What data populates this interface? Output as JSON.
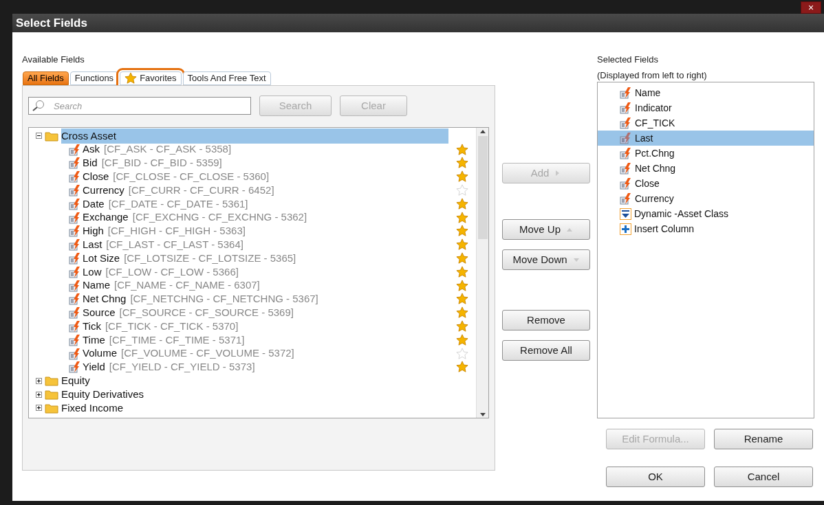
{
  "window": {
    "title": "Select Fields",
    "close": "×"
  },
  "available": {
    "label": "Available Fields",
    "tabs": [
      {
        "label": "All Fields",
        "selected": true,
        "star": false
      },
      {
        "label": "Functions",
        "selected": false,
        "star": false
      },
      {
        "label": "Favorites",
        "selected": false,
        "star": true
      },
      {
        "label": "Tools And Free Text",
        "selected": false,
        "star": false
      }
    ],
    "search": {
      "placeholder": "Search"
    },
    "search_button": {
      "label": "Search",
      "disabled": true
    },
    "clear_button": {
      "label": "Clear",
      "disabled": true
    },
    "tree": [
      {
        "label": "Cross Asset",
        "expanded": true,
        "selected": true,
        "children": [
          {
            "name": "Ask",
            "code": "[CF_ASK - CF_ASK - 5358]",
            "favorite": true
          },
          {
            "name": "Bid",
            "code": "[CF_BID - CF_BID - 5359]",
            "favorite": true
          },
          {
            "name": "Close",
            "code": "[CF_CLOSE - CF_CLOSE - 5360]",
            "favorite": true
          },
          {
            "name": "Currency",
            "code": "[CF_CURR - CF_CURR - 6452]",
            "favorite": false
          },
          {
            "name": "Date",
            "code": "[CF_DATE - CF_DATE - 5361]",
            "favorite": true
          },
          {
            "name": "Exchange",
            "code": "[CF_EXCHNG - CF_EXCHNG - 5362]",
            "favorite": true
          },
          {
            "name": "High",
            "code": "[CF_HIGH - CF_HIGH - 5363]",
            "favorite": true
          },
          {
            "name": "Last",
            "code": "[CF_LAST - CF_LAST - 5364]",
            "favorite": true
          },
          {
            "name": "Lot Size",
            "code": "[CF_LOTSIZE - CF_LOTSIZE - 5365]",
            "favorite": true
          },
          {
            "name": "Low",
            "code": "[CF_LOW - CF_LOW - 5366]",
            "favorite": true
          },
          {
            "name": "Name",
            "code": "[CF_NAME - CF_NAME - 6307]",
            "favorite": true
          },
          {
            "name": "Net Chng",
            "code": "[CF_NETCHNG - CF_NETCHNG - 5367]",
            "favorite": true
          },
          {
            "name": "Source",
            "code": "[CF_SOURCE - CF_SOURCE - 5369]",
            "favorite": true
          },
          {
            "name": "Tick",
            "code": "[CF_TICK - CF_TICK - 5370]",
            "favorite": true
          },
          {
            "name": "Time",
            "code": "[CF_TIME - CF_TIME - 5371]",
            "favorite": true
          },
          {
            "name": "Volume",
            "code": "[CF_VOLUME - CF_VOLUME - 5372]",
            "favorite": false
          },
          {
            "name": "Yield",
            "code": "[CF_YIELD - CF_YIELD - 5373]",
            "favorite": true
          }
        ]
      },
      {
        "label": "Equity",
        "expanded": false,
        "selected": false
      },
      {
        "label": "Equity Derivatives",
        "expanded": false,
        "selected": false
      },
      {
        "label": "Fixed Income",
        "expanded": false,
        "selected": false
      }
    ]
  },
  "middle_buttons": [
    {
      "label": "Add",
      "disabled": true,
      "kind": "right"
    },
    {
      "label": "Move Up",
      "disabled": false,
      "kind": "up"
    },
    {
      "label": "Move Down",
      "disabled": false,
      "kind": "down"
    },
    {
      "label": "Remove",
      "disabled": false,
      "kind": "plain"
    },
    {
      "label": "Remove All",
      "disabled": false,
      "kind": "plain"
    }
  ],
  "selected_fields": {
    "label": "Selected Fields",
    "sublabel": "(Displayed from left to right)",
    "items": [
      {
        "label": "Name",
        "kind": "field",
        "selected": false
      },
      {
        "label": "Indicator",
        "kind": "field",
        "selected": false
      },
      {
        "label": "CF_TICK",
        "kind": "field",
        "selected": false
      },
      {
        "label": "Last",
        "kind": "field",
        "selected": true
      },
      {
        "label": "Pct.Chng",
        "kind": "field",
        "selected": false
      },
      {
        "label": "Net Chng",
        "kind": "field",
        "selected": false
      },
      {
        "label": "Close",
        "kind": "field",
        "selected": false
      },
      {
        "label": "Currency",
        "kind": "field",
        "selected": false
      },
      {
        "label": "Dynamic -Asset Class",
        "kind": "dynamic",
        "selected": false
      },
      {
        "label": "Insert Column",
        "kind": "insert",
        "selected": false
      }
    ]
  },
  "bottom_buttons": [
    {
      "label": "Edit Formula...",
      "disabled": true
    },
    {
      "label": "Rename",
      "disabled": false
    },
    {
      "label": "OK",
      "disabled": false
    },
    {
      "label": "Cancel",
      "disabled": false
    }
  ]
}
